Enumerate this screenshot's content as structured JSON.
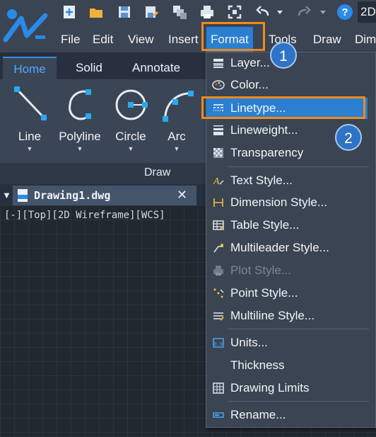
{
  "quick_access": {
    "icons": [
      "new-icon",
      "open-folder-icon",
      "save-icon",
      "save-as-icon",
      "layer-stack-icon",
      "print-icon",
      "fullscreen-icon",
      "undo-icon",
      "redo-icon",
      "help-icon"
    ],
    "workspace_label": "2D"
  },
  "menubar": {
    "items": [
      {
        "label": "File"
      },
      {
        "label": "Edit"
      },
      {
        "label": "View"
      },
      {
        "label": "Insert"
      },
      {
        "label": "Format"
      },
      {
        "label": "Tools"
      },
      {
        "label": "Draw"
      },
      {
        "label": "Dim"
      }
    ]
  },
  "ribbon": {
    "tabs": [
      {
        "label": "Home"
      },
      {
        "label": "Solid"
      },
      {
        "label": "Annotate"
      }
    ],
    "tools": [
      {
        "label": "Line"
      },
      {
        "label": "Polyline"
      },
      {
        "label": "Circle"
      },
      {
        "label": "Arc"
      }
    ],
    "panel_caption": "Draw"
  },
  "document": {
    "tab_title": "Drawing1.dwg",
    "close_glyph": "✕",
    "view_label": "[-][Top][2D Wireframe][WCS]"
  },
  "format_menu": {
    "items": [
      {
        "label": "Layer...",
        "icon": "layer-icon"
      },
      {
        "label": "Color...",
        "icon": "color-palette-icon"
      },
      {
        "label": "Linetype...",
        "icon": "linetype-icon",
        "highlighted": true
      },
      {
        "label": "Lineweight...",
        "icon": "lineweight-icon"
      },
      {
        "label": "Transparency",
        "icon": "transparency-icon"
      },
      {
        "label": "Text Style...",
        "icon": "text-style-icon"
      },
      {
        "label": "Dimension Style...",
        "icon": "dimension-style-icon"
      },
      {
        "label": "Table Style...",
        "icon": "table-style-icon"
      },
      {
        "label": "Multileader Style...",
        "icon": "multileader-style-icon"
      },
      {
        "label": "Plot Style...",
        "icon": "plot-style-icon",
        "disabled": true
      },
      {
        "label": "Point Style...",
        "icon": "point-style-icon"
      },
      {
        "label": "Multiline Style...",
        "icon": "multiline-style-icon"
      },
      {
        "label": "Units...",
        "icon": "units-icon"
      },
      {
        "label": "Thickness",
        "icon": ""
      },
      {
        "label": "Drawing Limits",
        "icon": "drawing-limits-icon"
      },
      {
        "label": "Rename...",
        "icon": "rename-icon"
      }
    ]
  },
  "callouts": {
    "step1": "1",
    "step2": "2"
  },
  "colors": {
    "accent": "#2a7fd1",
    "highlight_outline": "#f08a1c",
    "badge": "#2f73c6"
  }
}
